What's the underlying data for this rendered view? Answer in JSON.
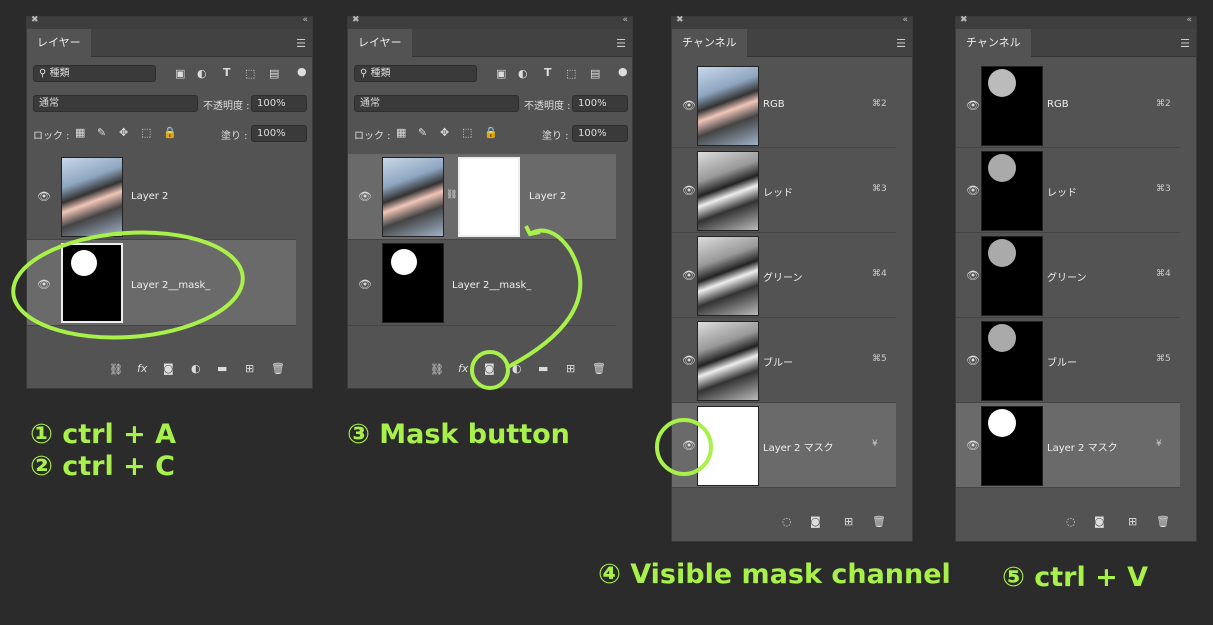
{
  "layers_panel": {
    "tab": "レイヤー",
    "filter": "種類",
    "blend": "通常",
    "opacity_label": "不透明度 :",
    "opacity": "100%",
    "lock_label": "ロック :",
    "fill_label": "塗り :",
    "fill": "100%",
    "fx": "fx"
  },
  "panel1": {
    "layer1": "Layer 2",
    "layer2": "Layer 2__mask_"
  },
  "panel2": {
    "layer1": "Layer 2",
    "layer2": "Layer 2__mask_"
  },
  "channels_panel": {
    "tab": "チャンネル",
    "rows": [
      {
        "name": "RGB",
        "key": "⌘2"
      },
      {
        "name": "レッド",
        "key": "⌘3"
      },
      {
        "name": "グリーン",
        "key": "⌘4"
      },
      {
        "name": "ブルー",
        "key": "⌘5"
      },
      {
        "name": "Layer 2 マスク",
        "key": "¥"
      }
    ]
  },
  "captions": {
    "c1": "① ctrl + A",
    "c2": "② ctrl + C",
    "c3": "③ Mask button",
    "c4": "④ Visible mask channel",
    "c5": "⑤ ctrl + V"
  },
  "colors": {
    "annotation": "#a8f04a",
    "panel": "#535353",
    "background": "#2b2b2b"
  }
}
